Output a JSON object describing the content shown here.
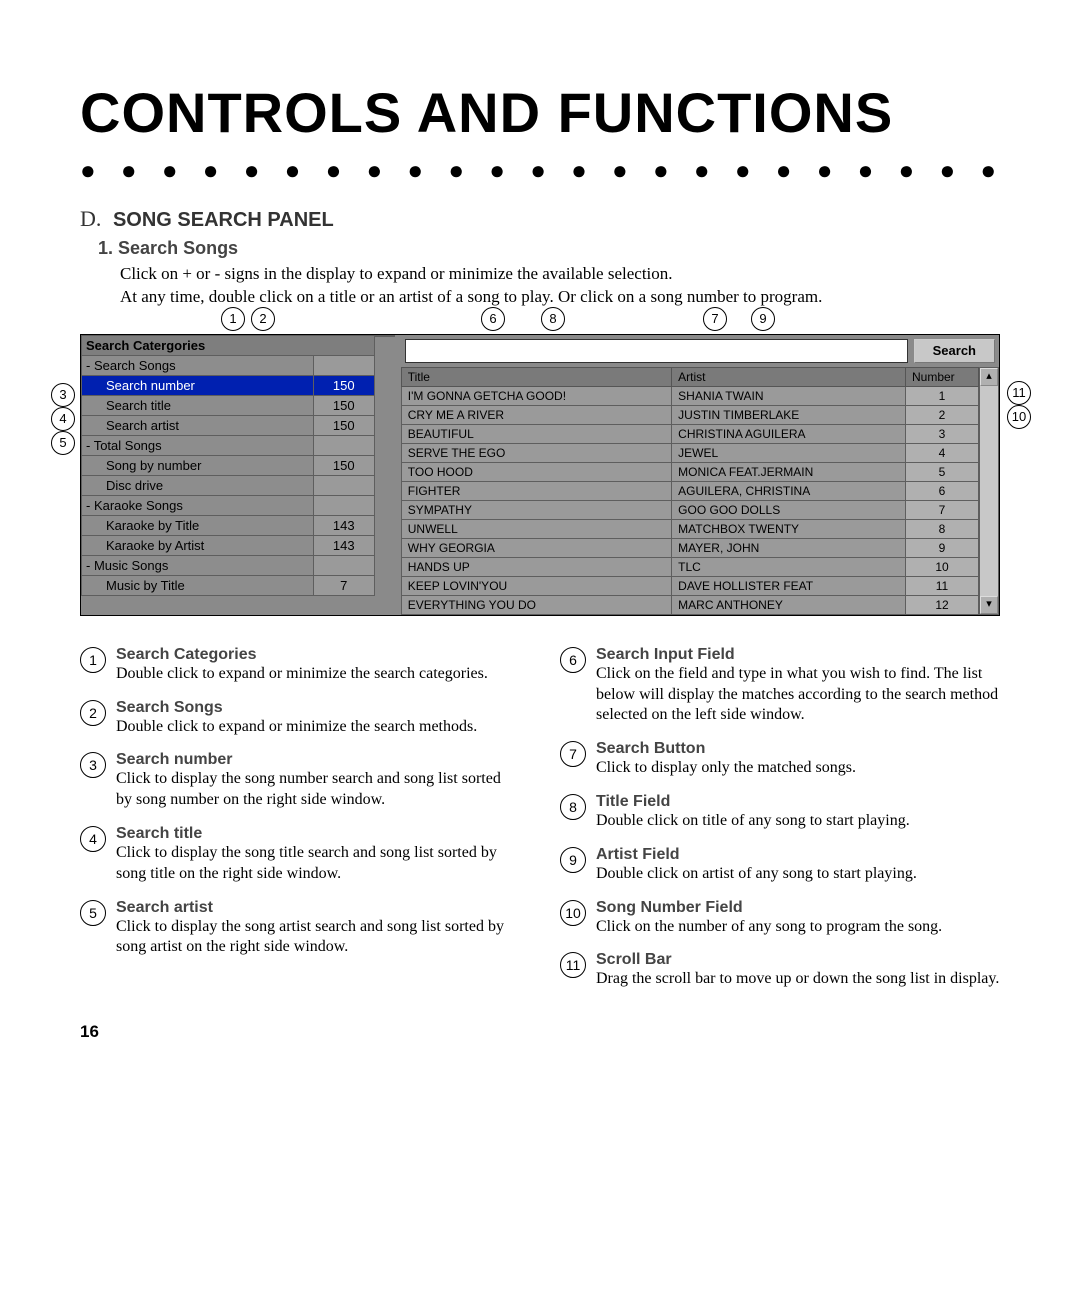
{
  "page_number": "16",
  "title": "CONTROLS AND FUNCTIONS",
  "section_letter": "D.",
  "section_title": "SONG SEARCH PANEL",
  "sub_number": "1.",
  "sub_title": "Search Songs",
  "intro_line1": "Click on + or - signs in the display to expand or minimize the available selection.",
  "intro_line2": "At any time, double click on a title or an artist of a song to play.  Or click on a song number to program.",
  "tree": {
    "header": "Search Catergories",
    "rows": [
      {
        "label": "Search Songs",
        "count": "",
        "bold": true,
        "sub": false,
        "sel": false,
        "expand": "-"
      },
      {
        "label": "Search number",
        "count": "150",
        "bold": false,
        "sub": true,
        "sel": true
      },
      {
        "label": "Search title",
        "count": "150",
        "bold": false,
        "sub": true,
        "sel": false
      },
      {
        "label": "Search artist",
        "count": "150",
        "bold": false,
        "sub": true,
        "sel": false
      },
      {
        "label": "Total Songs",
        "count": "",
        "bold": true,
        "sub": false,
        "sel": false,
        "expand": "-"
      },
      {
        "label": "Song by number",
        "count": "150",
        "bold": false,
        "sub": true,
        "sel": false
      },
      {
        "label": "Disc drive",
        "count": "",
        "bold": false,
        "sub": true,
        "sel": false
      },
      {
        "label": "Karaoke Songs",
        "count": "",
        "bold": true,
        "sub": false,
        "sel": false,
        "expand": "-"
      },
      {
        "label": "Karaoke by Title",
        "count": "143",
        "bold": false,
        "sub": true,
        "sel": false
      },
      {
        "label": "Karaoke by Artist",
        "count": "143",
        "bold": false,
        "sub": true,
        "sel": false
      },
      {
        "label": "Music Songs",
        "count": "",
        "bold": true,
        "sub": false,
        "sel": false,
        "expand": "-"
      },
      {
        "label": "Music by Title",
        "count": "7",
        "bold": false,
        "sub": true,
        "sel": false
      }
    ]
  },
  "search": {
    "placeholder": "",
    "button": "Search"
  },
  "result_headers": {
    "title": "Title",
    "artist": "Artist",
    "number": "Number"
  },
  "results": [
    {
      "title": "I'M GONNA GETCHA GOOD!",
      "artist": "SHANIA TWAIN",
      "num": "1"
    },
    {
      "title": "CRY ME A RIVER",
      "artist": "JUSTIN TIMBERLAKE",
      "num": "2"
    },
    {
      "title": "BEAUTIFUL",
      "artist": "CHRISTINA AGUILERA",
      "num": "3"
    },
    {
      "title": "SERVE THE EGO",
      "artist": "JEWEL",
      "num": "4"
    },
    {
      "title": "TOO HOOD",
      "artist": "MONICA FEAT.JERMAIN",
      "num": "5"
    },
    {
      "title": "FIGHTER",
      "artist": "AGUILERA, CHRISTINA",
      "num": "6"
    },
    {
      "title": "SYMPATHY",
      "artist": "GOO GOO DOLLS",
      "num": "7"
    },
    {
      "title": "UNWELL",
      "artist": "MATCHBOX TWENTY",
      "num": "8"
    },
    {
      "title": "WHY GEORGIA",
      "artist": "MAYER, JOHN",
      "num": "9"
    },
    {
      "title": "HANDS UP",
      "artist": "TLC",
      "num": "10"
    },
    {
      "title": "KEEP LOVIN'YOU",
      "artist": "DAVE HOLLISTER FEAT",
      "num": "11"
    },
    {
      "title": "EVERYTHING YOU DO",
      "artist": "MARC ANTHONEY",
      "num": "12"
    }
  ],
  "callouts_on_shot": [
    "1",
    "2",
    "3",
    "4",
    "5",
    "6",
    "7",
    "8",
    "9",
    "10",
    "11"
  ],
  "defs_left": [
    {
      "n": "1",
      "h": "Search Categories",
      "d": "Double click to expand or minimize the search categories."
    },
    {
      "n": "2",
      "h": "Search Songs",
      "d": "Double click to expand or minimize the search methods."
    },
    {
      "n": "3",
      "h": "Search number",
      "d": "Click to display the song number search and song list sorted by song number on the right side window."
    },
    {
      "n": "4",
      "h": "Search title",
      "d": "Click to display the song title search and song list sorted by song title on the right side window."
    },
    {
      "n": "5",
      "h": "Search artist",
      "d": "Click to display the song artist search and song list sorted by song artist on the right side window."
    }
  ],
  "defs_right": [
    {
      "n": "6",
      "h": "Search Input Field",
      "d": "Click on the field and type in what you wish to find. The list below will display the matches according to the search method selected on the left side window."
    },
    {
      "n": "7",
      "h": "Search Button",
      "d": "Click to display only the matched songs."
    },
    {
      "n": "8",
      "h": "Title Field",
      "d": "Double click on title of any song to start playing."
    },
    {
      "n": "9",
      "h": "Artist Field",
      "d": "Double click on artist of any song to start playing."
    },
    {
      "n": "10",
      "h": "Song Number Field",
      "d": "Click on the number of any song to program the song."
    },
    {
      "n": "11",
      "h": "Scroll Bar",
      "d": "Drag the scroll bar to move up or down the song list in display."
    }
  ]
}
